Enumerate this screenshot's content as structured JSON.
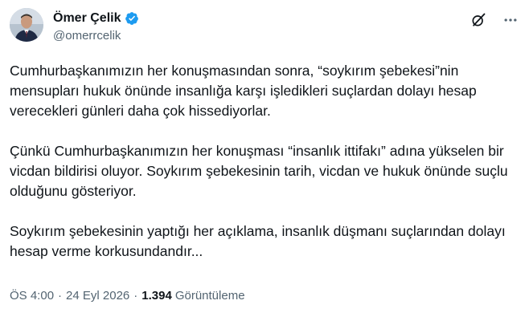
{
  "author": {
    "display_name": "Ömer Çelik",
    "handle": "@omerrcelik",
    "verified": true,
    "verified_color": "#1d9bf0"
  },
  "header_actions": [
    {
      "icon": "grok-slash-icon"
    },
    {
      "icon": "more-options-icon"
    }
  ],
  "paragraphs": [
    "Cumhurbaşkanımızın her konuşmasından sonra, “soykırım şebekesi”nin mensupları hukuk önünde insanlığa karşı işledikleri suçlardan dolayı hesap verecekleri günleri daha çok hissediyorlar.",
    "Çünkü Cumhurbaşkanımızın her konuşması “insanlık ittifakı” adına yükselen bir vicdan bildirisi oluyor. Soykırım şebekesinin tarih, vicdan ve hukuk önünde suçlu olduğunu gösteriyor.",
    "Soykırım şebekesinin yaptığı her açıklama, insanlık düşmanı suçlarından dolayı hesap verme korkusundandır..."
  ],
  "meta": {
    "time": "ÖS 4:00",
    "separator": "·",
    "date": "24 Eyl 2026",
    "views_count": "1.394",
    "views_label": "Görüntüleme"
  },
  "colors": {
    "text": "#0f1419",
    "secondary": "#536471",
    "background": "#ffffff"
  }
}
